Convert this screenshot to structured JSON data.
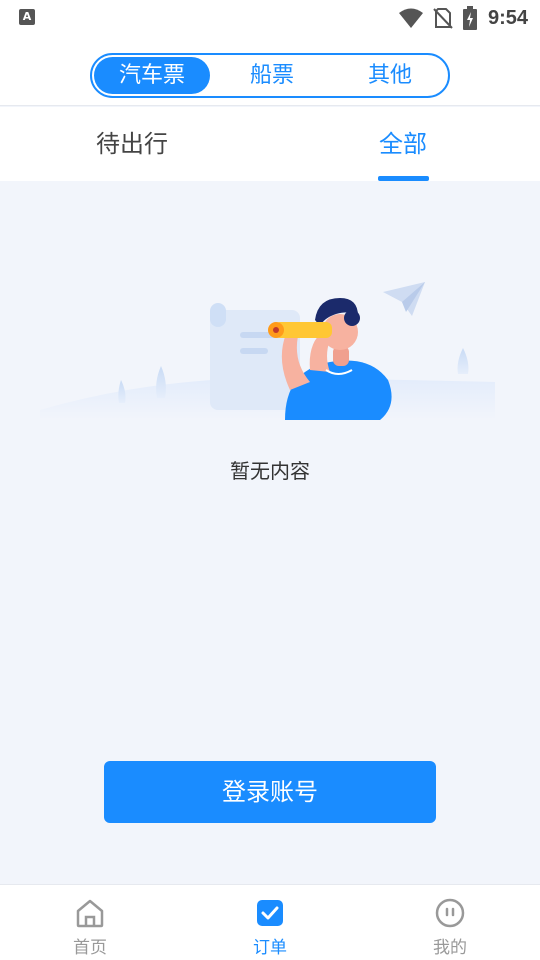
{
  "status_bar": {
    "left_icon": "A",
    "icons": [
      "wifi-icon",
      "no-sim-icon",
      "battery-charging-icon"
    ],
    "time": "9:54"
  },
  "header": {
    "segments": [
      {
        "label": "汽车票",
        "active": true
      },
      {
        "label": "船票",
        "active": false
      },
      {
        "label": "其他",
        "active": false
      }
    ]
  },
  "tabs": [
    {
      "label": "待出行",
      "active": false
    },
    {
      "label": "全部",
      "active": true
    }
  ],
  "empty_state": {
    "illustration": "person-with-telescope-illustration",
    "text": "暂无内容"
  },
  "login_button": {
    "label": "登录账号"
  },
  "bottom_nav": [
    {
      "label": "首页",
      "icon": "home-icon",
      "active": false
    },
    {
      "label": "订单",
      "icon": "order-check-icon",
      "active": true
    },
    {
      "label": "我的",
      "icon": "profile-face-icon",
      "active": false
    }
  ],
  "colors": {
    "accent": "#1a8cff",
    "background": "#f2f5fb",
    "inactive": "#999999"
  }
}
